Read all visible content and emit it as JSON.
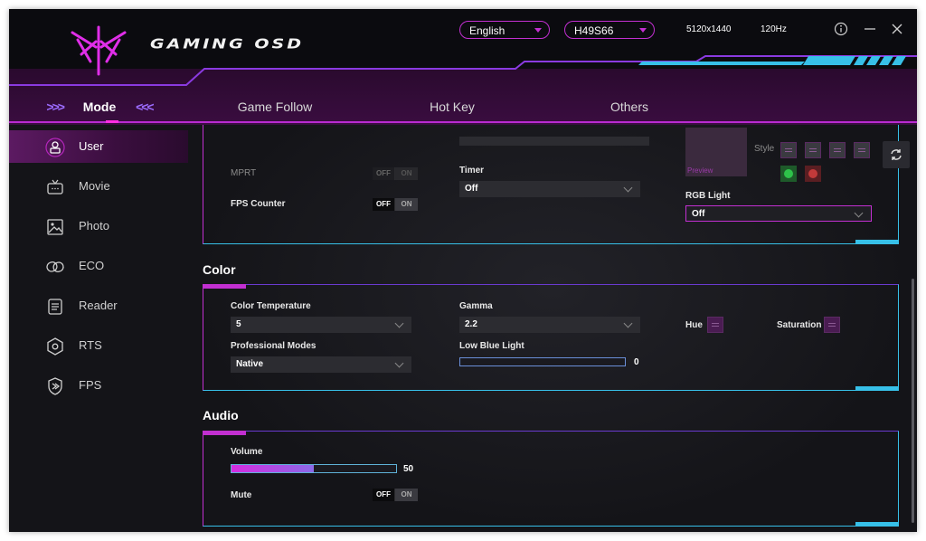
{
  "header": {
    "brand": "GAMING OSD",
    "language": "English",
    "model": "H49S66",
    "resolution": "5120x1440",
    "refresh_rate": "120Hz",
    "info_icon": "info-icon",
    "minimize_icon": "minimize-icon",
    "close_icon": "close-icon"
  },
  "tabs": {
    "left_chevrons": ">>>",
    "right_chevrons": "<<<",
    "items": [
      {
        "label": "Mode",
        "active": true
      },
      {
        "label": "Game Follow"
      },
      {
        "label": "Hot Key"
      },
      {
        "label": "Others"
      }
    ]
  },
  "sidebar": {
    "items": [
      {
        "label": "User",
        "icon": "user-icon",
        "active": true
      },
      {
        "label": "Movie",
        "icon": "tv-icon"
      },
      {
        "label": "Photo",
        "icon": "image-icon"
      },
      {
        "label": "ECO",
        "icon": "eco-icon"
      },
      {
        "label": "Reader",
        "icon": "reader-icon"
      },
      {
        "label": "RTS",
        "icon": "rts-icon"
      },
      {
        "label": "FPS",
        "icon": "fps-icon"
      }
    ]
  },
  "game_panel": {
    "mprt_label": "MPRT",
    "mprt_off": "OFF",
    "mprt_on": "ON",
    "fps_counter_label": "FPS Counter",
    "fps_off": "OFF",
    "fps_on": "ON",
    "timer_label": "Timer",
    "timer_value": "Off",
    "preview_label": "Preview",
    "style_label": "Style",
    "rgb_light_label": "RGB Light",
    "rgb_light_value": "Off"
  },
  "color": {
    "title": "Color",
    "color_temp_label": "Color Temperature",
    "color_temp_value": "5",
    "gamma_label": "Gamma",
    "gamma_value": "2.2",
    "hue_label": "Hue",
    "saturation_label": "Saturation",
    "professional_label": "Professional Modes",
    "professional_value": "Native",
    "low_blue_label": "Low Blue Light",
    "low_blue_value": "0",
    "low_blue_level": 0
  },
  "audio": {
    "title": "Audio",
    "volume_label": "Volume",
    "volume_value": "50",
    "volume_level": 50,
    "mute_label": "Mute",
    "mute_off": "OFF",
    "mute_on": "ON"
  },
  "colors": {
    "accent_magenta": "#c22fd1",
    "accent_cyan": "#37c0e8",
    "background": "#0e0e12"
  }
}
